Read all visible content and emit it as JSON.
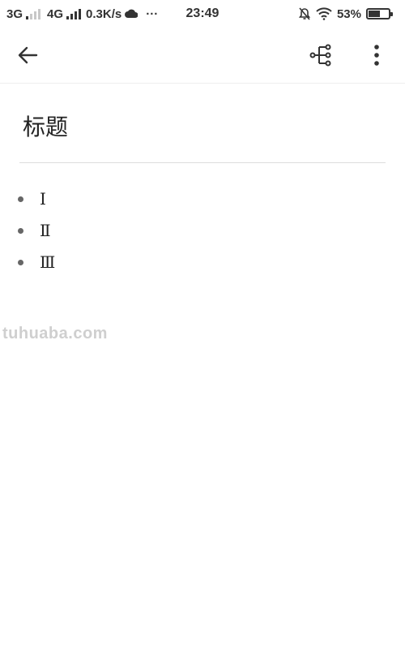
{
  "status_bar": {
    "network1": "3G",
    "network2": "4G",
    "speed": "0.3K/s",
    "more": "···",
    "time": "23:49",
    "battery_percent": "53%",
    "battery_level": 0.53
  },
  "app_bar": {
    "back_icon": "arrow-left-icon",
    "mindmap_icon": "tree-structure-icon",
    "more_icon": "more-vertical-icon"
  },
  "document": {
    "title": "标题",
    "items": [
      {
        "label": "Ⅰ"
      },
      {
        "label": "Ⅱ"
      },
      {
        "label": "Ⅲ"
      }
    ]
  },
  "watermark": "tuhuaba.com",
  "colors": {
    "text": "#222222",
    "bullet": "#666666",
    "divider": "#dddddd",
    "watermark": "#cfcfcf"
  }
}
